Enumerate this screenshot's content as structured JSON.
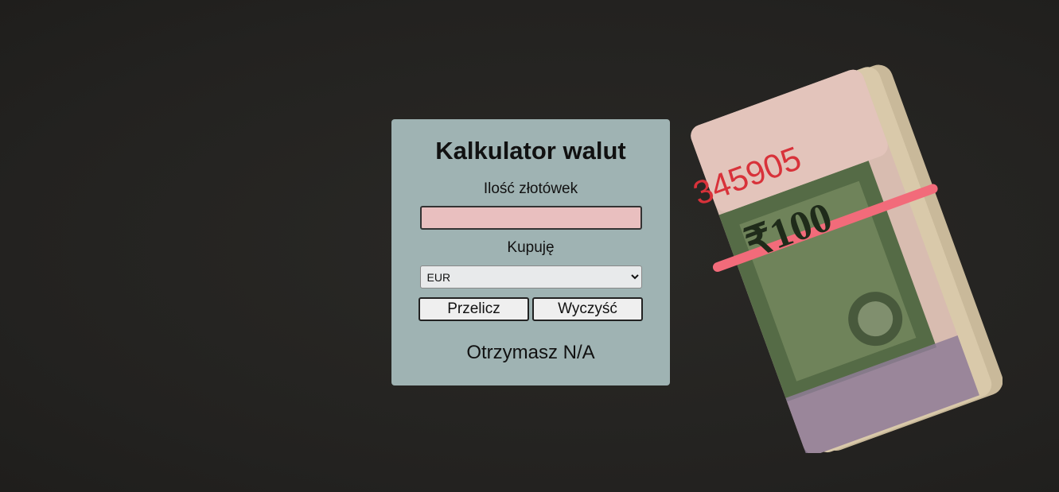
{
  "calculator": {
    "title": "Kalkulator walut",
    "amount_label": "Ilość złotówek",
    "amount_value": "",
    "currency_label": "Kupuję",
    "currency_selected": "EUR",
    "convert_button": "Przelicz",
    "clear_button": "Wyczyść",
    "result_text": "Otrzymasz N/A"
  },
  "background": {
    "banknote_serial": "345905",
    "banknote_value": "₹100"
  },
  "colors": {
    "page_background": "#252422",
    "card_background": "#9fb3b3",
    "input_background": "#e9bfbf",
    "select_background": "#e8eaeb",
    "button_background": "#efefef",
    "rubber_band": "#f26b7a"
  }
}
